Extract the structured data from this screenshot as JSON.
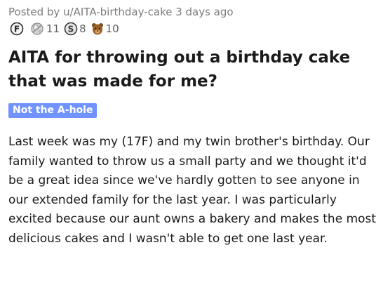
{
  "post": {
    "meta": "Posted by u/AITA-birthday-cake 3 days ago",
    "awards": [
      {
        "icon": "f-award-icon",
        "count": ""
      },
      {
        "icon": "silver-award-icon",
        "count": "11"
      },
      {
        "icon": "s-award-icon",
        "count": "8"
      },
      {
        "icon": "bear-award-icon",
        "count": "10"
      }
    ],
    "title": "AITA for throwing out a birthday cake that was made for me?",
    "flair": "Not the A-hole",
    "body": "Last week was my (17F) and my twin brother's birthday. Our family wanted to throw us a small party and we thought it'd be a great idea since we've hardly gotten to see anyone in our extended family for the last year. I was particularly excited because our aunt owns a bakery and makes the most delicious cakes and I wasn't able to get one last year."
  },
  "colors": {
    "flair_background": "#7193ff",
    "meta_text": "#7c7c7c",
    "title_text": "#1a1a1b"
  }
}
